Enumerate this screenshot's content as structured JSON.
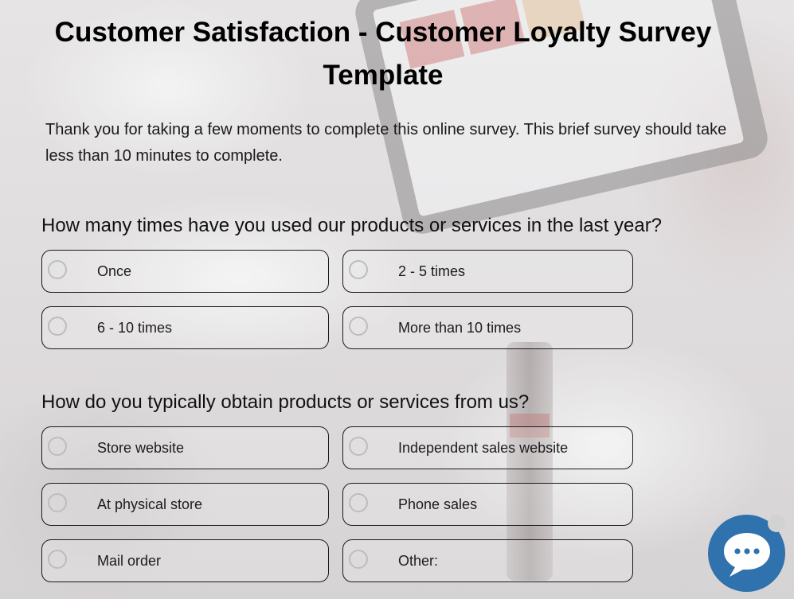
{
  "survey": {
    "title": "Customer Satisfaction - Customer Loyalty Survey Template",
    "intro": "Thank you for taking a few moments to complete this online survey.  This brief survey should take less than 10 minutes to complete."
  },
  "questions": [
    {
      "text": "How many times have you used our products or services in the last year?",
      "options": [
        "Once",
        "2 - 5 times",
        "6 - 10 times",
        "More than 10 times"
      ]
    },
    {
      "text": "How do you typically obtain products or services from us?",
      "options": [
        "Store website",
        "Independent sales website",
        "At physical store",
        "Phone sales",
        "Mail order",
        "Other:"
      ]
    }
  ],
  "chat_widget": {
    "icon": "chat-bubble-icon",
    "color": "#2f72ad"
  }
}
